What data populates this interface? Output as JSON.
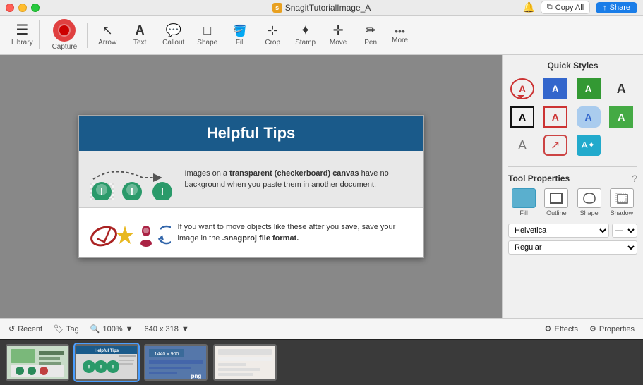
{
  "window": {
    "title": "SnagitTutorialImage_A"
  },
  "titlebar": {
    "copy_all_label": "Copy All",
    "share_label": "Share"
  },
  "toolbar": {
    "items": [
      {
        "id": "library",
        "label": "Library"
      },
      {
        "id": "capture",
        "label": "Capture"
      },
      {
        "id": "arrow",
        "label": "Arrow"
      },
      {
        "id": "text",
        "label": "Text"
      },
      {
        "id": "callout",
        "label": "Callout"
      },
      {
        "id": "shape",
        "label": "Shape"
      },
      {
        "id": "fill",
        "label": "Fill"
      },
      {
        "id": "crop",
        "label": "Crop"
      },
      {
        "id": "stamp",
        "label": "Stamp"
      },
      {
        "id": "move",
        "label": "Move"
      },
      {
        "id": "pen",
        "label": "Pen"
      },
      {
        "id": "more",
        "label": "More"
      }
    ]
  },
  "canvas": {
    "zoom": "100%",
    "dimensions": "640 x 318",
    "image": {
      "header": "Helpful Tips",
      "top_text": "Images on a transparent (checkerboard) canvas have no background when you paste them in another document.",
      "bottom_text": "If you want to move objects like these after you save, save your image in the .snagproj file format."
    }
  },
  "quick_styles": {
    "title": "Quick Styles"
  },
  "tool_properties": {
    "title": "Tool Properties",
    "help_label": "?",
    "tabs": [
      {
        "id": "fill",
        "label": "Fill"
      },
      {
        "id": "outline",
        "label": "Outline"
      },
      {
        "id": "shape",
        "label": "Shape"
      },
      {
        "id": "shadow",
        "label": "Shadow"
      }
    ],
    "font": "Helvetica",
    "font_style": "Regular"
  },
  "statusbar": {
    "recent_label": "Recent",
    "tag_label": "Tag",
    "zoom_label": "100%",
    "dimensions_label": "640 x 318",
    "effects_label": "Effects",
    "properties_label": "Properties"
  }
}
